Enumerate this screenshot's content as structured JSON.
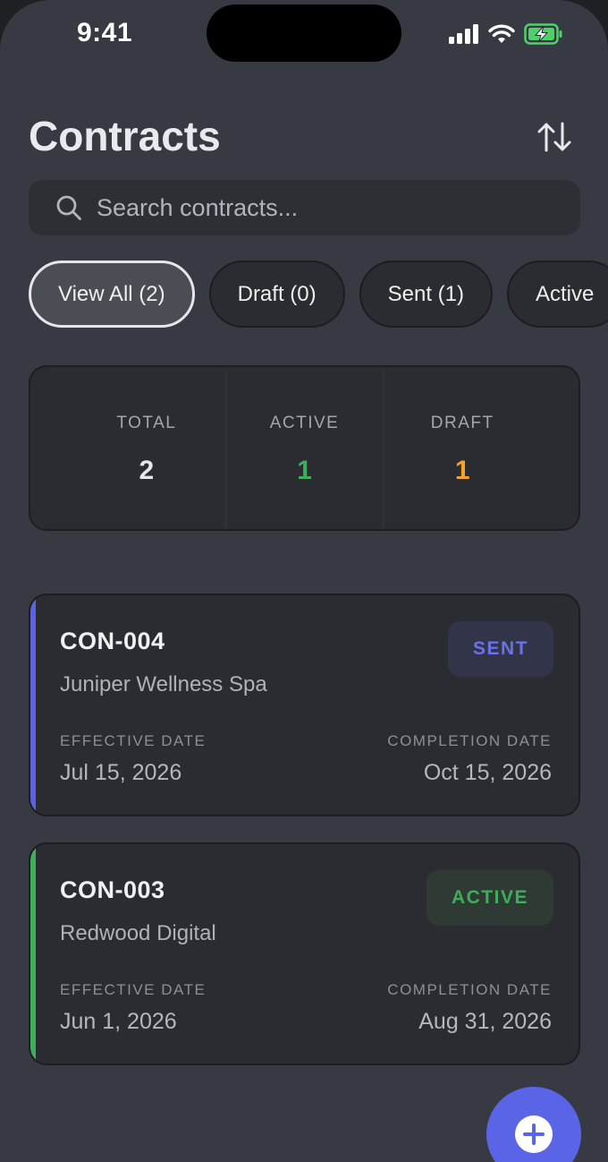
{
  "status_bar": {
    "time": "9:41"
  },
  "header": {
    "title": "Contracts"
  },
  "search": {
    "placeholder": "Search contracts..."
  },
  "filters": [
    {
      "label": "View All (2)",
      "selected": true
    },
    {
      "label": "Draft (0)",
      "selected": false
    },
    {
      "label": "Sent (1)",
      "selected": false
    },
    {
      "label": "Active",
      "selected": false
    }
  ],
  "stats": [
    {
      "label": "TOTAL",
      "value": "2",
      "color": "#e6e7ea"
    },
    {
      "label": "ACTIVE",
      "value": "1",
      "color": "#3fae5a"
    },
    {
      "label": "DRAFT",
      "value": "1",
      "color": "#f4a428"
    }
  ],
  "contracts": [
    {
      "id": "CON-004",
      "client": "Juniper Wellness Spa",
      "status": "SENT",
      "status_color": "#6a72e8",
      "status_bg": "#32344a",
      "accent_color": "#5b63e2",
      "effective_label": "EFFECTIVE DATE",
      "effective_date": "Jul 15, 2026",
      "completion_label": "COMPLETION DATE",
      "completion_date": "Oct 15, 2026"
    },
    {
      "id": "CON-003",
      "client": "Redwood Digital",
      "status": "ACTIVE",
      "status_color": "#3fae5a",
      "status_bg": "#2e3a33",
      "accent_color": "#3fae5a",
      "effective_label": "EFFECTIVE DATE",
      "effective_date": "Jun 1, 2026",
      "completion_label": "COMPLETION DATE",
      "completion_date": "Aug 31, 2026"
    }
  ],
  "icons": {
    "sort": "sort-arrows-icon",
    "search": "search-icon",
    "fab": "plus-circle-icon"
  },
  "colors": {
    "brand": "#5a64e6",
    "background": "#373a43",
    "card": "#2b2c31"
  }
}
